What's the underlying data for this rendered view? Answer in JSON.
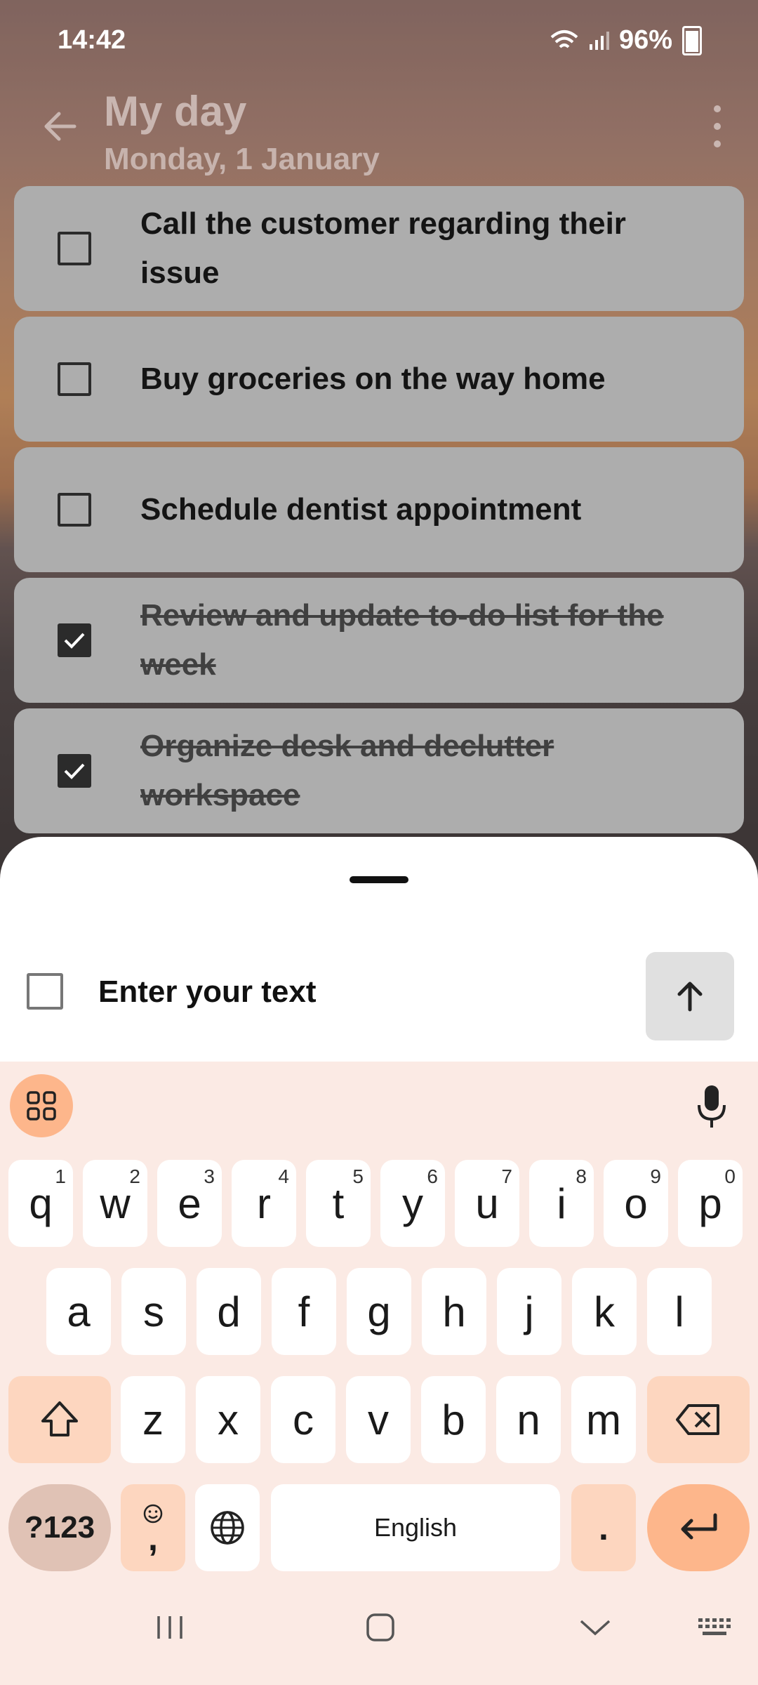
{
  "status_bar": {
    "time": "14:42",
    "battery": "96%"
  },
  "header": {
    "title": "My day",
    "subtitle": "Monday, 1 January"
  },
  "tasks": [
    {
      "text": "Call the customer regarding their issue",
      "done": false
    },
    {
      "text": "Buy groceries on the way home",
      "done": false
    },
    {
      "text": "Schedule dentist appointment",
      "done": false
    },
    {
      "text": "Review and update to-do list for the week",
      "done": true
    },
    {
      "text": "Organize desk and declutter workspace",
      "done": true
    }
  ],
  "new_task": {
    "placeholder": "Enter your text"
  },
  "keyboard": {
    "row1": [
      {
        "k": "q",
        "n": "1"
      },
      {
        "k": "w",
        "n": "2"
      },
      {
        "k": "e",
        "n": "3"
      },
      {
        "k": "r",
        "n": "4"
      },
      {
        "k": "t",
        "n": "5"
      },
      {
        "k": "y",
        "n": "6"
      },
      {
        "k": "u",
        "n": "7"
      },
      {
        "k": "i",
        "n": "8"
      },
      {
        "k": "o",
        "n": "9"
      },
      {
        "k": "p",
        "n": "0"
      }
    ],
    "row2": [
      "a",
      "s",
      "d",
      "f",
      "g",
      "h",
      "j",
      "k",
      "l"
    ],
    "row3": [
      "z",
      "x",
      "c",
      "v",
      "b",
      "n",
      "m"
    ],
    "symbols_label": "?123",
    "emoji_comma": ",",
    "space_label": "English",
    "period": "."
  },
  "colors": {
    "accent": "#fdb68b",
    "keyboard_bg": "#fbeae4",
    "task_card": "#adadad"
  }
}
